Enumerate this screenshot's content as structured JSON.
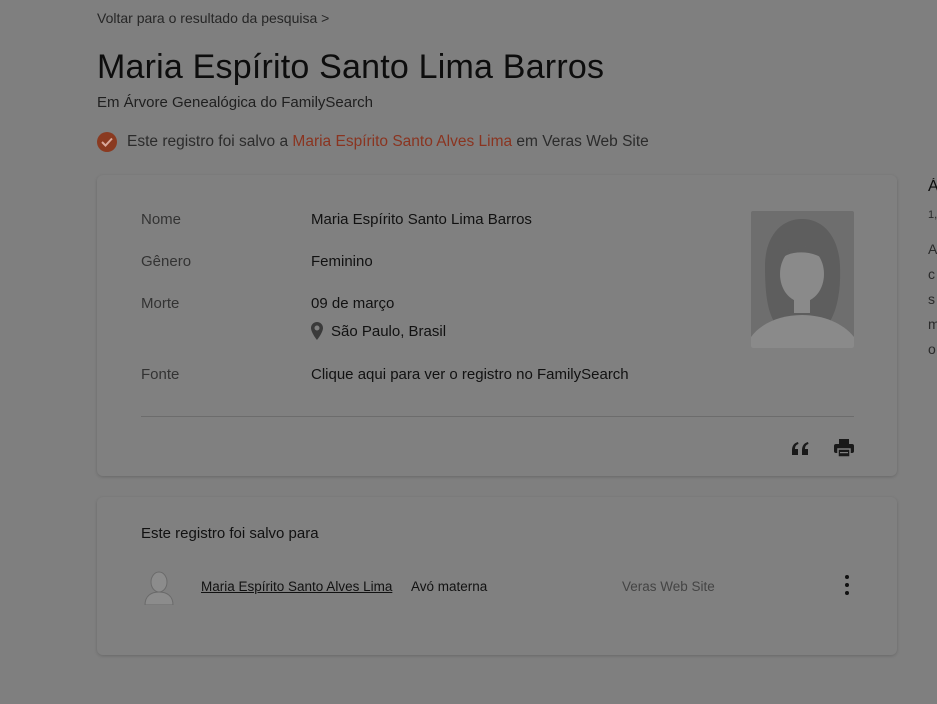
{
  "nav": {
    "back_link": "Voltar para o resultado da pesquisa >"
  },
  "header": {
    "title": "Maria Espírito Santo Lima Barros",
    "subtitle": "Em Árvore Genealógica do FamilySearch"
  },
  "saved_notice": {
    "prefix": "Este registro foi salvo a",
    "person": "Maria Espírito Santo Alves Lima",
    "suffix": "em Veras Web Site"
  },
  "details": {
    "name_label": "Nome",
    "name_value": "Maria Espírito Santo Lima Barros",
    "gender_label": "Gênero",
    "gender_value": "Feminino",
    "death_label": "Morte",
    "death_date": "09 de março",
    "death_place": "São Paulo, Brasil",
    "source_label": "Fonte",
    "source_link": "Clique aqui para ver o registro no FamilySearch"
  },
  "saved_for": {
    "title": "Este registro foi salvo para",
    "person_name": "Maria Espírito Santo Alves Lima",
    "relation": "Avó materna",
    "site": "Veras Web Site"
  },
  "side_panel": {
    "line1": "Á",
    "line2": "1,",
    "line3": "A",
    "line4": "c",
    "line5": "s",
    "line6": "m",
    "line7": "o"
  },
  "colors": {
    "background": "#7f7f7f",
    "card": "#808080",
    "accent": "#8a3420"
  },
  "icons": [
    "check-icon",
    "location-pin-icon",
    "silhouette-icon",
    "quote-icon",
    "print-icon",
    "kebab-menu-icon",
    "avatar-icon"
  ]
}
